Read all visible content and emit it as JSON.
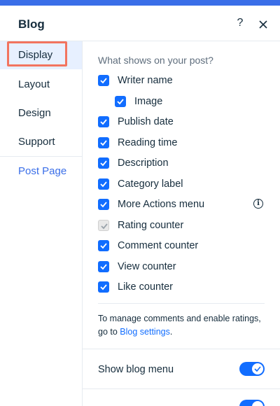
{
  "panel": {
    "title": "Blog",
    "help_glyph": "?"
  },
  "sidebar": {
    "items": [
      {
        "label": "Display",
        "active": true
      },
      {
        "label": "Layout"
      },
      {
        "label": "Design"
      },
      {
        "label": "Support"
      }
    ],
    "link": {
      "label": "Post Page"
    }
  },
  "display": {
    "section_label": "What shows on your post?",
    "options": [
      {
        "label": "Writer name",
        "checked": true
      },
      {
        "label": "Image",
        "checked": true,
        "indent": true
      },
      {
        "label": "Publish date",
        "checked": true
      },
      {
        "label": "Reading time",
        "checked": true
      },
      {
        "label": "Description",
        "checked": true
      },
      {
        "label": "Category label",
        "checked": true
      },
      {
        "label": "More Actions menu",
        "checked": true,
        "info": true
      },
      {
        "label": "Rating counter",
        "checked": true,
        "disabled": true
      },
      {
        "label": "Comment counter",
        "checked": true
      },
      {
        "label": "View counter",
        "checked": true
      },
      {
        "label": "Like counter",
        "checked": true
      }
    ],
    "note_text": "To manage comments and enable ratings, go to ",
    "note_link": "Blog settings",
    "note_end": ".",
    "toggle_label": "Show blog menu",
    "toggle_on": true
  },
  "colors": {
    "accent": "#116dff",
    "top_bar": "#3a6ee8",
    "highlight_border": "#f2745f",
    "active_bg": "#e7f0ff"
  }
}
